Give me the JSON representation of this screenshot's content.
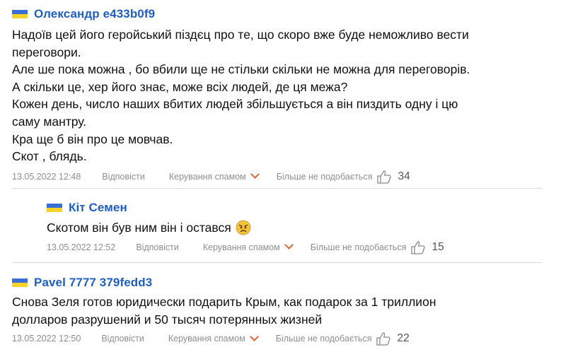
{
  "comments": [
    {
      "author": "Олександр e433b0f9",
      "lines": [
        "Надоїв цей його геройський піздєц про те, що скоро вже буде неможливо вести",
        "переговори.",
        "Але ше пока можна , бо вбили ще не стільки скільки не можна для переговорів.",
        "А скільки це, хер його знає, може всіх людей, де ця межа?",
        "Кожен день, число наших вбитих людей збільшується а він пиздить одну і цю",
        "саму мантру.",
        "Кра ще б він про це мовчав.",
        "Скот , блядь."
      ],
      "date": "13.05.2022 12:48",
      "reply_label": "Відповісти",
      "spam_label": "Керування спамом",
      "dislike_label": "Більше не подобається",
      "likes": "34"
    },
    {
      "author": "Кіт Семен",
      "lines": [
        "Скотом він був ним він і остався"
      ],
      "date": "13.05.2022 12:52",
      "reply_label": "Відповісти",
      "spam_label": "Керування спамом",
      "dislike_label": "Більше не подобається",
      "likes": "15"
    },
    {
      "author": "Pavel 7777 379fedd3",
      "lines": [
        "Снова Зеля готов юридически подарить Крым, как подарок за 1 триллион",
        "долларов разрушений и 50 тысяч потерянных жизней"
      ],
      "date": "13.05.2022 12:50",
      "reply_label": "Відповісти",
      "spam_label": "Керування спамом",
      "dislike_label": "Більше не подобається",
      "likes": "22"
    }
  ],
  "colors": {
    "author": "#1f5fc1",
    "flag_blue": "#3a6fd8",
    "flag_yellow": "#f6d32b",
    "chevron": "#e0633a",
    "meta_text": "#8f8f8f"
  },
  "icons": [
    "ukraine-flag-icon",
    "chevron-down-icon",
    "thumbs-up-icon",
    "angry-face-emoji"
  ]
}
